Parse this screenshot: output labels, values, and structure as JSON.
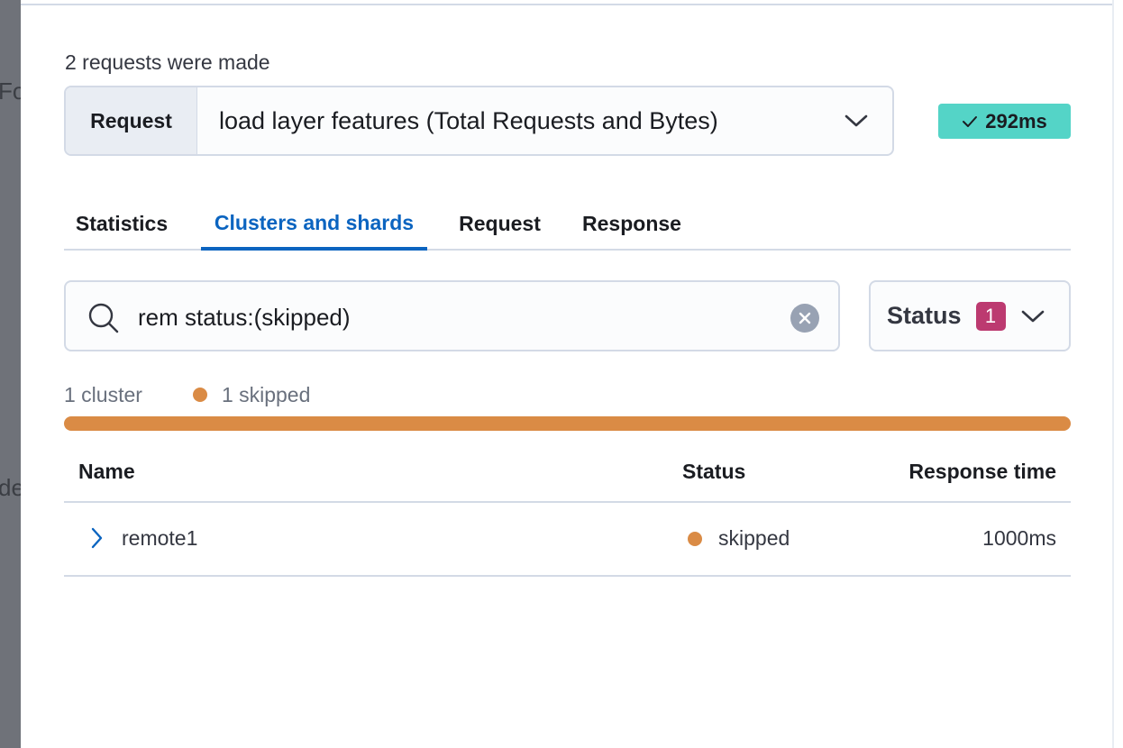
{
  "backdrop": {
    "fragments": [
      "Fo",
      "de"
    ]
  },
  "inspector": {
    "requests_count_label": "2 requests were made",
    "request_select": {
      "prepend_label": "Request",
      "selected_value": "load layer features (Total Requests and Bytes)"
    },
    "time_badge": {
      "icon": "check-icon",
      "label": "292ms",
      "color": "#54d4c7"
    },
    "tabs": [
      {
        "label": "Statistics",
        "active": false
      },
      {
        "label": "Clusters and shards",
        "active": true
      },
      {
        "label": "Request",
        "active": false
      },
      {
        "label": "Response",
        "active": false
      }
    ],
    "search": {
      "value": "rem status:(skipped)",
      "icon": "search-icon"
    },
    "status_filter": {
      "label": "Status",
      "count": "1"
    },
    "summary": {
      "cluster_count": "1 cluster",
      "skipped_label": "1 skipped",
      "skipped_color": "#da8b45",
      "skipped_fraction": 1.0
    },
    "table": {
      "columns": [
        "Name",
        "Status",
        "Response time"
      ],
      "rows": [
        {
          "name": "remote1",
          "status": "skipped",
          "response_time": "1000ms"
        }
      ]
    }
  }
}
